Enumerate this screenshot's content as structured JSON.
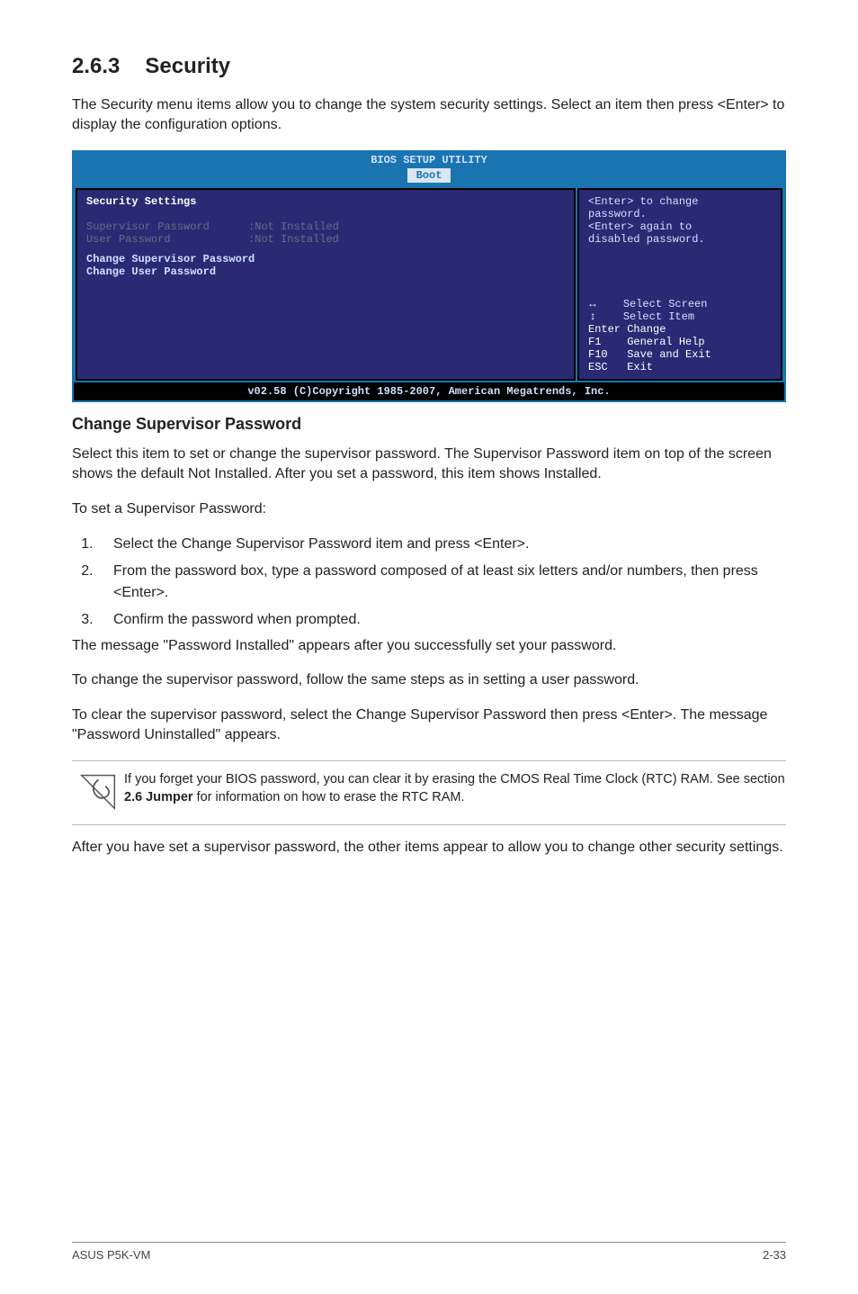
{
  "section": {
    "number": "2.6.3",
    "title": "Security"
  },
  "intro": "The Security menu items allow you to change the system security settings. Select an item then press <Enter> to display the configuration options.",
  "bios": {
    "title": "BIOS SETUP UTILITY",
    "tab": "Boot",
    "heading": "Security Settings",
    "supervisor_label": "Supervisor Password",
    "supervisor_value": ":Not Installed",
    "user_label": "User Password",
    "user_value": ":Not Installed",
    "opt1": "Change Supervisor Password",
    "opt2": "Change User Password",
    "help_l1": "<Enter> to change",
    "help_l2": "password.",
    "help_l3": "<Enter> again to",
    "help_l4": "disabled password.",
    "nav_select_screen": "Select Screen",
    "nav_select_item": "Select Item",
    "nav_enter": "Enter Change",
    "nav_f1": "F1    General Help",
    "nav_f10": "F10   Save and Exit",
    "nav_esc": "ESC   Exit",
    "copyright": "v02.58 (C)Copyright 1985-2007, American Megatrends, Inc."
  },
  "subheading": "Change Supervisor Password",
  "para1": "Select this item to set or change the supervisor password. The Supervisor Password item on top of the screen shows the default Not Installed. After you set a password, this item shows Installed.",
  "para2": "To set a Supervisor Password:",
  "steps": {
    "s1": "Select the Change Supervisor Password item and press <Enter>.",
    "s2": "From the password box, type a password composed of at least six letters and/or numbers, then press <Enter>.",
    "s3": "Confirm the password when prompted."
  },
  "para3": "The message \"Password Installed\" appears after you successfully set your password.",
  "para4": "To change the supervisor password, follow the same steps as in setting a user password.",
  "para5": "To clear the supervisor password, select the Change Supervisor Password then press <Enter>. The message \"Password Uninstalled\" appears.",
  "note_pre": "If you forget your BIOS password, you can clear it by erasing the CMOS Real Time Clock (RTC) RAM. See section ",
  "note_bold": "2.6 Jumper",
  "note_post": " for information on how to erase the RTC RAM.",
  "para6": "After you have set a supervisor password, the other items appear to allow you to change other security settings.",
  "footer": {
    "left": "ASUS P5K-VM",
    "right": "2-33"
  }
}
